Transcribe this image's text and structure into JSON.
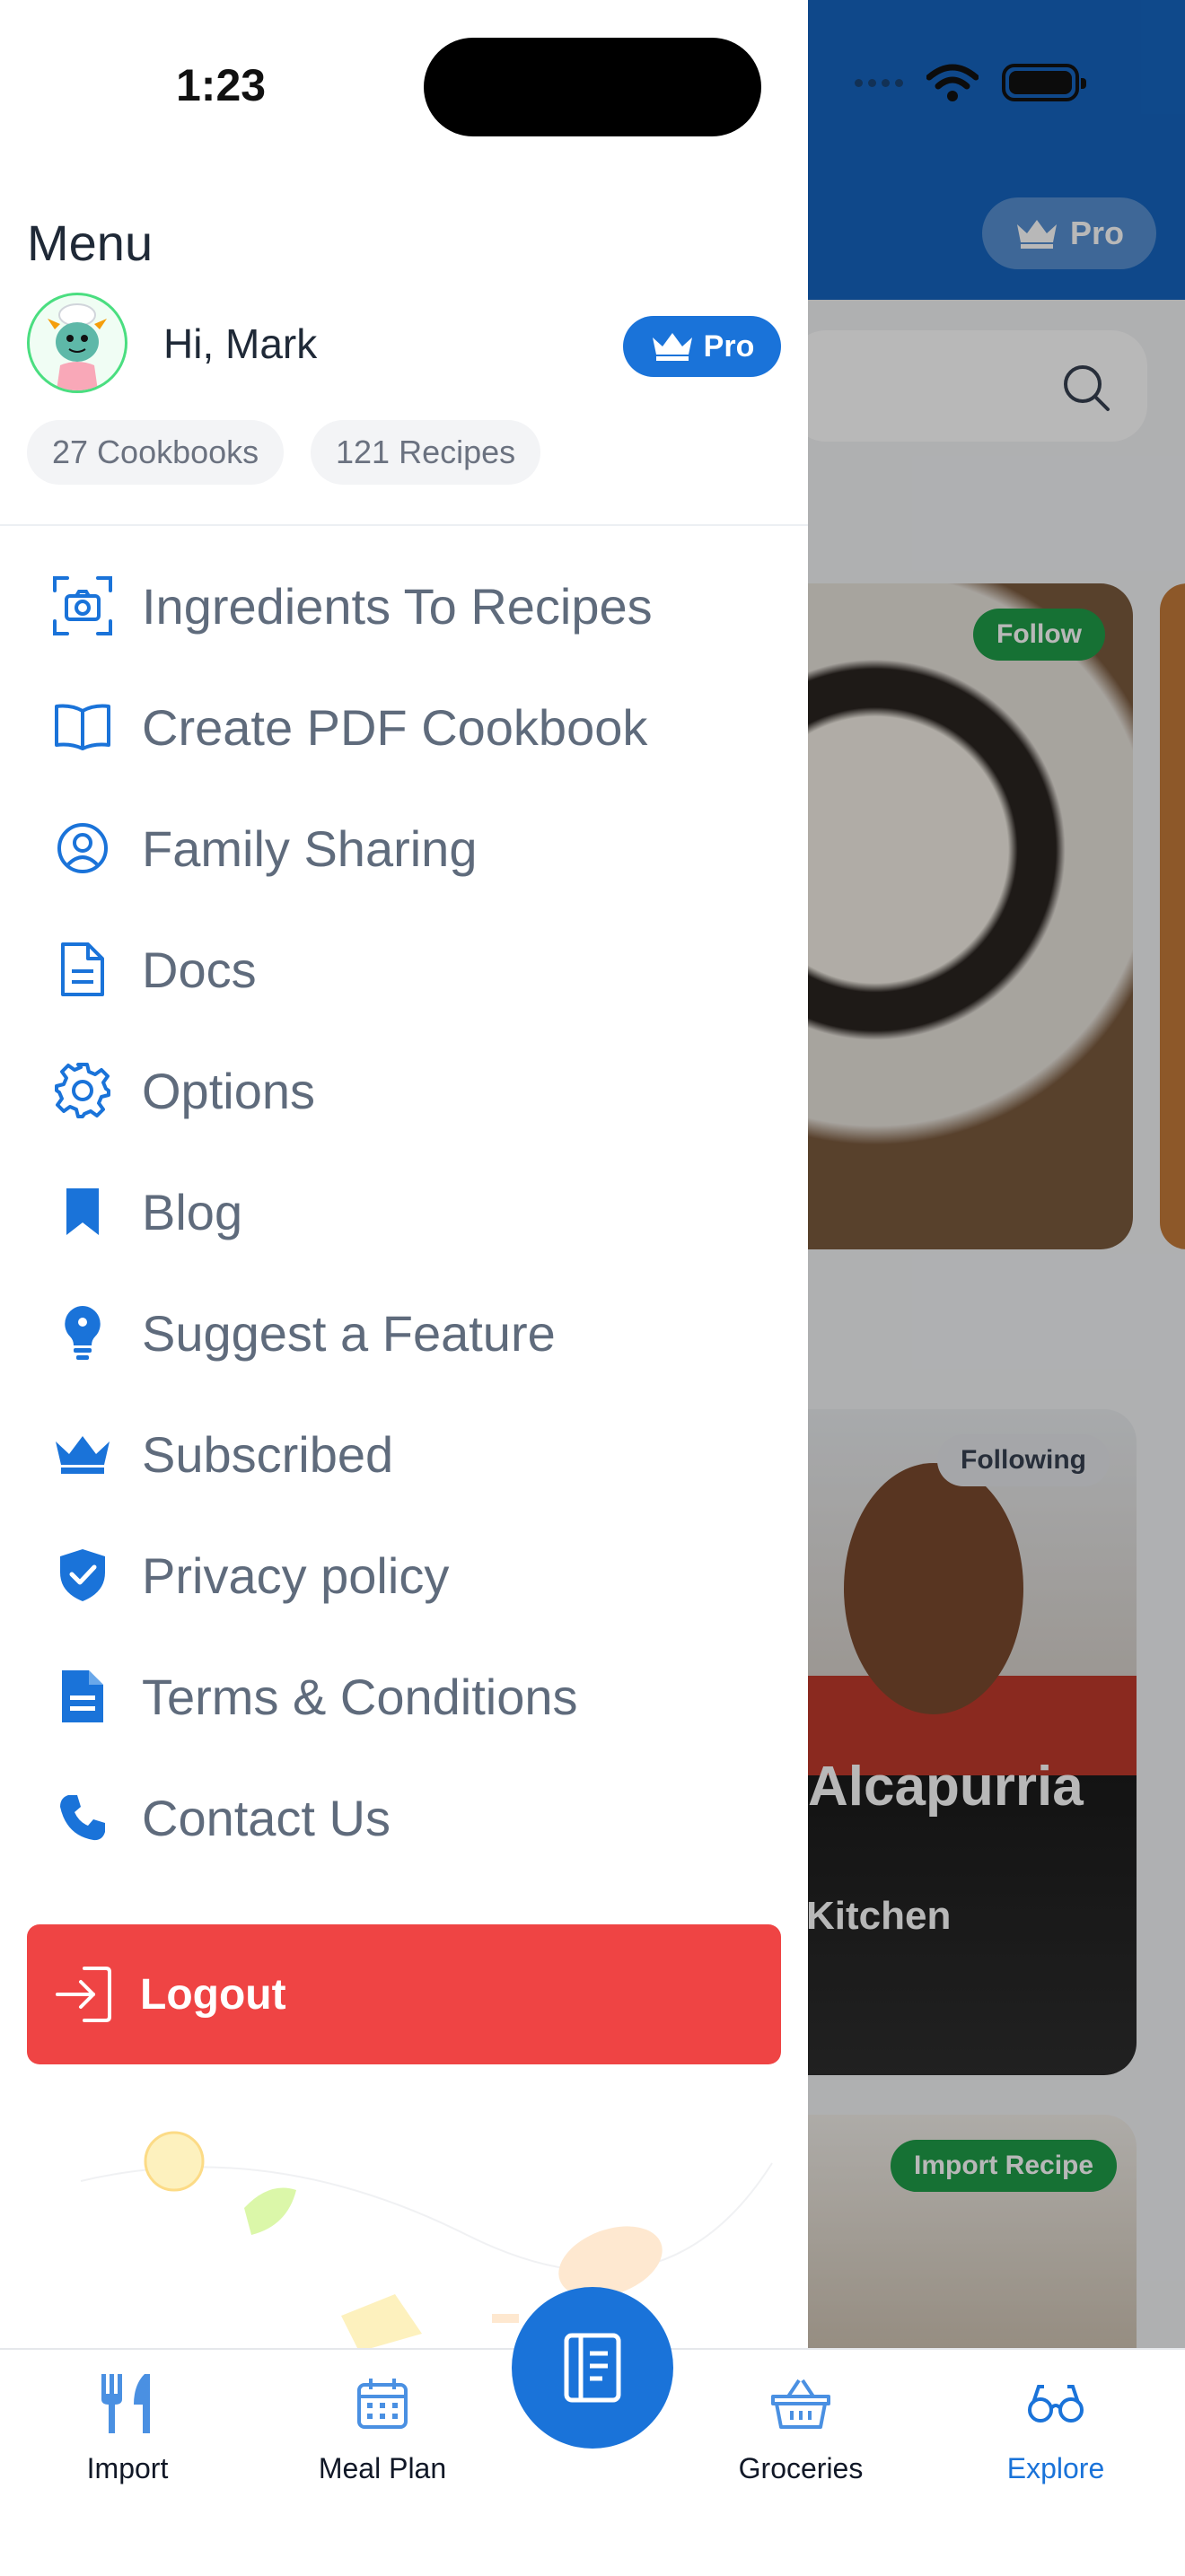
{
  "status_bar": {
    "time": "1:23"
  },
  "background": {
    "pro_label": "Pro",
    "cards": [
      {
        "badge": "Follow"
      },
      {
        "badge": "Following",
        "overlay_title": "Alcapurria",
        "overlay_subtitle": "Kitchen"
      },
      {
        "badge": "Import Recipe"
      }
    ]
  },
  "drawer": {
    "title": "Menu",
    "greeting": "Hi, Mark",
    "pro_badge": "Pro",
    "stats": {
      "cookbooks": "27 Cookbooks",
      "recipes": "121 Recipes"
    },
    "items": [
      {
        "label": "Ingredients To Recipes",
        "icon": "camera-scan-icon"
      },
      {
        "label": "Create PDF Cookbook",
        "icon": "open-book-icon"
      },
      {
        "label": "Family Sharing",
        "icon": "user-circle-icon"
      },
      {
        "label": "Docs",
        "icon": "document-icon"
      },
      {
        "label": "Options",
        "icon": "gear-icon"
      },
      {
        "label": "Blog",
        "icon": "bookmark-icon"
      },
      {
        "label": "Suggest a Feature",
        "icon": "lightbulb-icon"
      },
      {
        "label": "Subscribed",
        "icon": "crown-icon"
      },
      {
        "label": "Privacy policy",
        "icon": "shield-check-icon"
      },
      {
        "label": "Terms & Conditions",
        "icon": "file-text-icon"
      },
      {
        "label": "Contact Us",
        "icon": "phone-icon"
      }
    ],
    "logout_label": "Logout"
  },
  "tabbar": {
    "tabs": [
      {
        "label": "Import",
        "icon": "fork-knife-icon"
      },
      {
        "label": "Meal Plan",
        "icon": "calendar-icon"
      },
      {
        "label": "Groceries",
        "icon": "basket-icon"
      },
      {
        "label": "Explore",
        "icon": "glasses-icon",
        "active": true
      }
    ],
    "center_icon": "cookbook-icon"
  },
  "colors": {
    "accent": "#1a73d9",
    "header": "#1565c0",
    "logout": "#ef4444",
    "text": "#5f6b7c"
  }
}
